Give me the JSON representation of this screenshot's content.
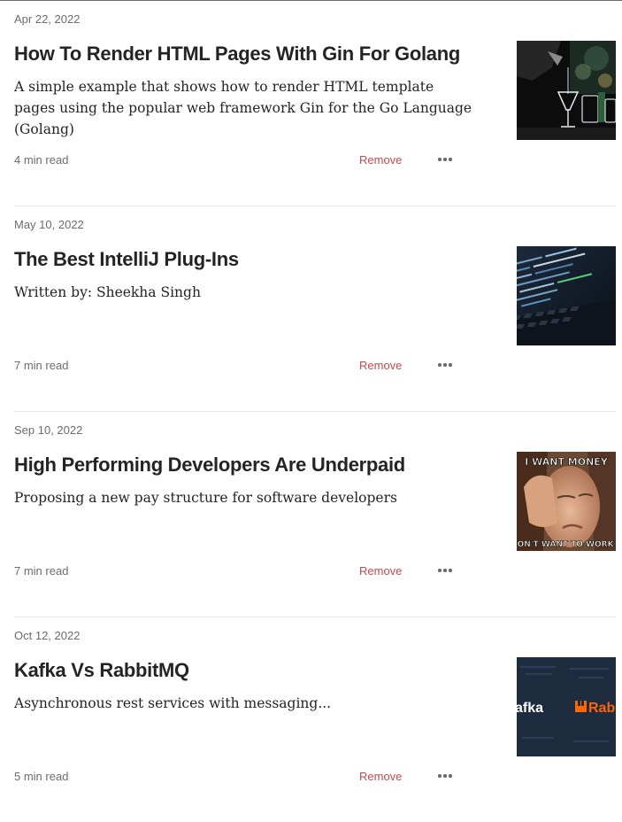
{
  "articles": [
    {
      "date": "Apr 22, 2022",
      "title": "How To Render HTML Pages With Gin For Golang",
      "subtitle": "A simple example that shows how to render HTML template pages using the popular web framework Gin for the Go Language (Golang)",
      "read_time": "4 min read",
      "remove_label": "Remove",
      "thumbnail_icon": "cocktail-bar-photo"
    },
    {
      "date": "May 10, 2022",
      "title": "The Best IntelliJ Plug-Ins",
      "subtitle": "Written by: Sheekha Singh",
      "read_time": "7 min read",
      "remove_label": "Remove",
      "thumbnail_icon": "code-on-laptop-photo"
    },
    {
      "date": "Sep 10, 2022",
      "title": "High Performing Developers Are Underpaid",
      "subtitle": "Proposing a new pay structure for software developers",
      "read_time": "7 min read",
      "remove_label": "Remove",
      "thumbnail_icon": "meme-photo",
      "thumbnail_text_top": "I WANT MONEY",
      "thumbnail_text_bottom": "DON'T WANT TO WORK F"
    },
    {
      "date": "Oct 12, 2022",
      "title": "Kafka Vs RabbitMQ",
      "subtitle": "Asynchronous rest services with messaging...",
      "read_time": "5 min read",
      "remove_label": "Remove",
      "thumbnail_icon": "kafka-rabbitmq-banner",
      "thumbnail_text_left": "afka",
      "thumbnail_text_right": "Rabb"
    }
  ],
  "colors": {
    "remove": "#c94a4a",
    "meta": "#6b6b6b",
    "divider": "#e6e6e6",
    "kafka_bg": "#1d2c3e",
    "rabbit_orange": "#ff6600"
  }
}
